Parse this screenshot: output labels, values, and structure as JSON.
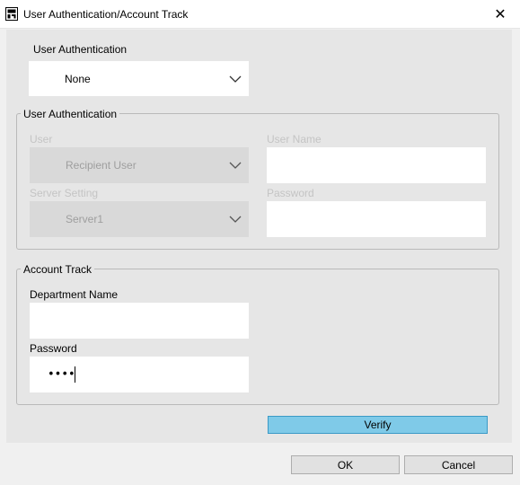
{
  "window": {
    "title": "User Authentication/Account Track",
    "close_symbol": "✕"
  },
  "user_auth_top": {
    "label": "User Authentication",
    "selected": "None"
  },
  "user_auth_group": {
    "title": "User Authentication",
    "user_label": "User",
    "user_selected": "Recipient User",
    "username_label": "User Name",
    "username_value": "",
    "server_label": "Server Setting",
    "server_selected": "Server1",
    "password_label": "Password",
    "password_value": ""
  },
  "account_track_group": {
    "title": "Account Track",
    "department_label": "Department Name",
    "department_value": "",
    "password_label": "Password",
    "password_mask": "••••"
  },
  "buttons": {
    "verify": "Verify",
    "ok": "OK",
    "cancel": "Cancel"
  },
  "colors": {
    "verify_bg": "#7fcae8",
    "verify_border": "#3b9ac6"
  }
}
